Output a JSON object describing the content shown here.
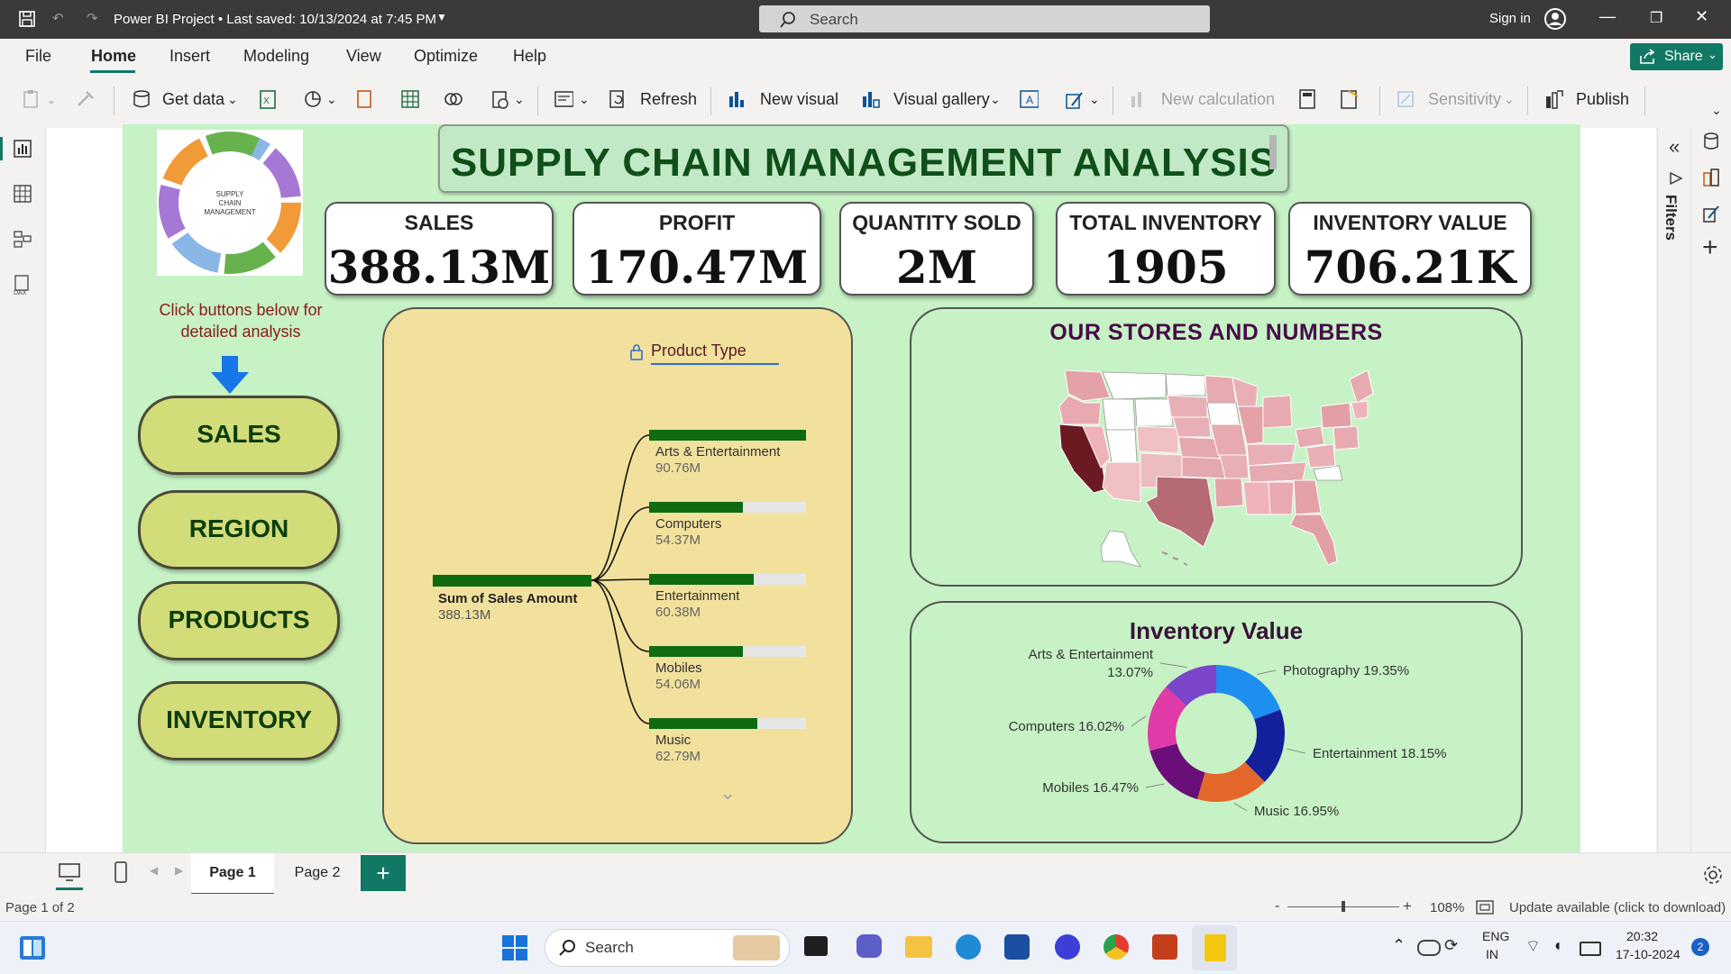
{
  "titlebar": {
    "title": "Power BI Project • Last saved: 10/13/2024 at 7:45 PM",
    "search_placeholder": "Search",
    "signin": "Sign in"
  },
  "menu": {
    "items": [
      "File",
      "Home",
      "Insert",
      "Modeling",
      "View",
      "Optimize",
      "Help"
    ],
    "active": "Home",
    "share": "Share"
  },
  "ribbon": {
    "get_data": "Get data",
    "refresh": "Refresh",
    "new_visual": "New visual",
    "visual_gallery": "Visual gallery",
    "new_calculation": "New calculation",
    "sensitivity": "Sensitivity",
    "publish": "Publish"
  },
  "rightpane": {
    "filters": "Filters"
  },
  "report": {
    "title": "SUPPLY CHAIN MANAGEMENT ANALYSIS",
    "logo_text": [
      "SUPPLY",
      "CHAIN",
      "MANAGEMENT"
    ],
    "hint": [
      "Click buttons below for",
      "detailed analysis"
    ],
    "kpis": [
      {
        "label": "SALES",
        "value": "388.13M"
      },
      {
        "label": "PROFIT",
        "value": "170.47M"
      },
      {
        "label": "QUANTITY SOLD",
        "value": "2M"
      },
      {
        "label": "TOTAL INVENTORY",
        "value": "1905"
      },
      {
        "label": "INVENTORY VALUE",
        "value": "706.21K"
      }
    ],
    "nav_buttons": [
      "SALES",
      "REGION",
      "PRODUCTS",
      "INVENTORY"
    ],
    "map_title": "OUR STORES AND NUMBERS",
    "donut_title": "Inventory Value"
  },
  "decomposition": {
    "field": "Product Type",
    "root": {
      "label": "Sum of Sales Amount",
      "value": "388.13M"
    },
    "children": [
      {
        "label": "Arts & Entertainment",
        "value": "90.76M",
        "amount": 90.76
      },
      {
        "label": "Computers",
        "value": "54.37M",
        "amount": 54.37
      },
      {
        "label": "Entertainment",
        "value": "60.38M",
        "amount": 60.38
      },
      {
        "label": "Mobiles",
        "value": "54.06M",
        "amount": 54.06
      },
      {
        "label": "Music",
        "value": "62.79M",
        "amount": 62.79
      }
    ],
    "max": 90.76,
    "colors": {
      "bar": "#0e6b10",
      "track": "#e6e6e6"
    }
  },
  "chart_data": {
    "type": "pie",
    "title": "Inventory Value",
    "slices": [
      {
        "name": "Photography",
        "value": 19.35,
        "label": "Photography 19.35%",
        "color": "#1e8ef0"
      },
      {
        "name": "Entertainment",
        "value": 18.15,
        "label": "Entertainment 18.15%",
        "color": "#13209a"
      },
      {
        "name": "Music",
        "value": 16.95,
        "label": "Music 16.95%",
        "color": "#e4682b"
      },
      {
        "name": "Mobiles",
        "value": 16.47,
        "label": "Mobiles 16.47%",
        "color": "#6b0f78"
      },
      {
        "name": "Computers",
        "value": 16.02,
        "label": "Computers 16.02%",
        "color": "#e03aa8"
      },
      {
        "name": "Arts & Entertainment",
        "value": 13.07,
        "label_lines": [
          "Arts & Entertainment",
          "13.07%"
        ],
        "color": "#7a45c8"
      }
    ],
    "legend": "none"
  },
  "pages": {
    "tabs": [
      "Page 1",
      "Page 2"
    ],
    "active": "Page 1"
  },
  "status": {
    "page_info": "Page 1 of 2",
    "zoom": "108%",
    "update": "Update available (click to download)"
  },
  "taskbar": {
    "search": "Search",
    "lang_top": "ENG",
    "lang_bottom": "IN",
    "time": "20:32",
    "date": "17-10-2024",
    "badge": "2"
  }
}
